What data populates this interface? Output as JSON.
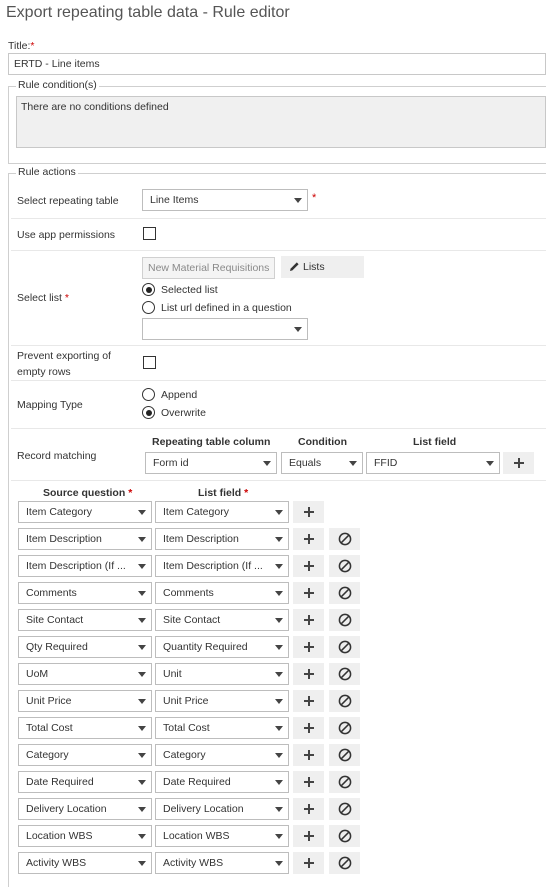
{
  "window_title": "Export repeating table data - Rule editor",
  "title_field": {
    "label": "Title:",
    "value": "ERTD - Line items"
  },
  "rule_conditions": {
    "legend": "Rule condition(s)",
    "text": "There are no conditions defined"
  },
  "rule_actions": {
    "legend": "Rule actions",
    "select_repeating_table": {
      "label": "Select repeating table",
      "value": "Line Items"
    },
    "use_app_permissions": {
      "label": "Use app permissions",
      "checked": false
    },
    "select_list": {
      "label": "Select list",
      "list_button": "New Material Requisitions",
      "lists_button": "Lists",
      "option_selected_list": "Selected list",
      "option_list_url": "List url defined in a question",
      "selected_option": "Selected list",
      "url_question_value": ""
    },
    "prevent_exporting": {
      "label_line1": "Prevent exporting of",
      "label_line2": "empty rows",
      "checked": false
    },
    "mapping_type": {
      "label": "Mapping Type",
      "option_append": "Append",
      "option_overwrite": "Overwrite",
      "selected": "Overwrite"
    },
    "record_matching": {
      "label": "Record matching",
      "headers": {
        "repeating_table_column": "Repeating table column",
        "condition": "Condition",
        "list_field": "List field"
      },
      "repeating_table_column": "Form id",
      "condition": "Equals",
      "list_field": "FFID"
    },
    "mapping": {
      "headers": {
        "source_question": "Source question",
        "list_field": "List field"
      },
      "rows": [
        {
          "source": "Item Category",
          "field": "Item Category"
        },
        {
          "source": "Item Description",
          "field": "Item Description"
        },
        {
          "source": "Item Description (If ...",
          "field": "Item Description (If ..."
        },
        {
          "source": "Comments",
          "field": "Comments"
        },
        {
          "source": "Site Contact",
          "field": "Site Contact"
        },
        {
          "source": "Qty Required",
          "field": "Quantity Required"
        },
        {
          "source": "UoM",
          "field": "Unit"
        },
        {
          "source": "Unit Price",
          "field": "Unit Price"
        },
        {
          "source": "Total Cost",
          "field": "Total Cost"
        },
        {
          "source": "Category",
          "field": "Category"
        },
        {
          "source": "Date Required",
          "field": "Date Required"
        },
        {
          "source": "Delivery Location",
          "field": "Delivery Location"
        },
        {
          "source": "Location WBS",
          "field": "Location WBS"
        },
        {
          "source": "Activity WBS",
          "field": "Activity WBS"
        }
      ]
    }
  },
  "required_marker": "*",
  "icons": {
    "add": "plus-icon",
    "remove": "remove-circle-icon",
    "edit": "pencil-icon",
    "dropdown": "chevron-down-icon"
  }
}
